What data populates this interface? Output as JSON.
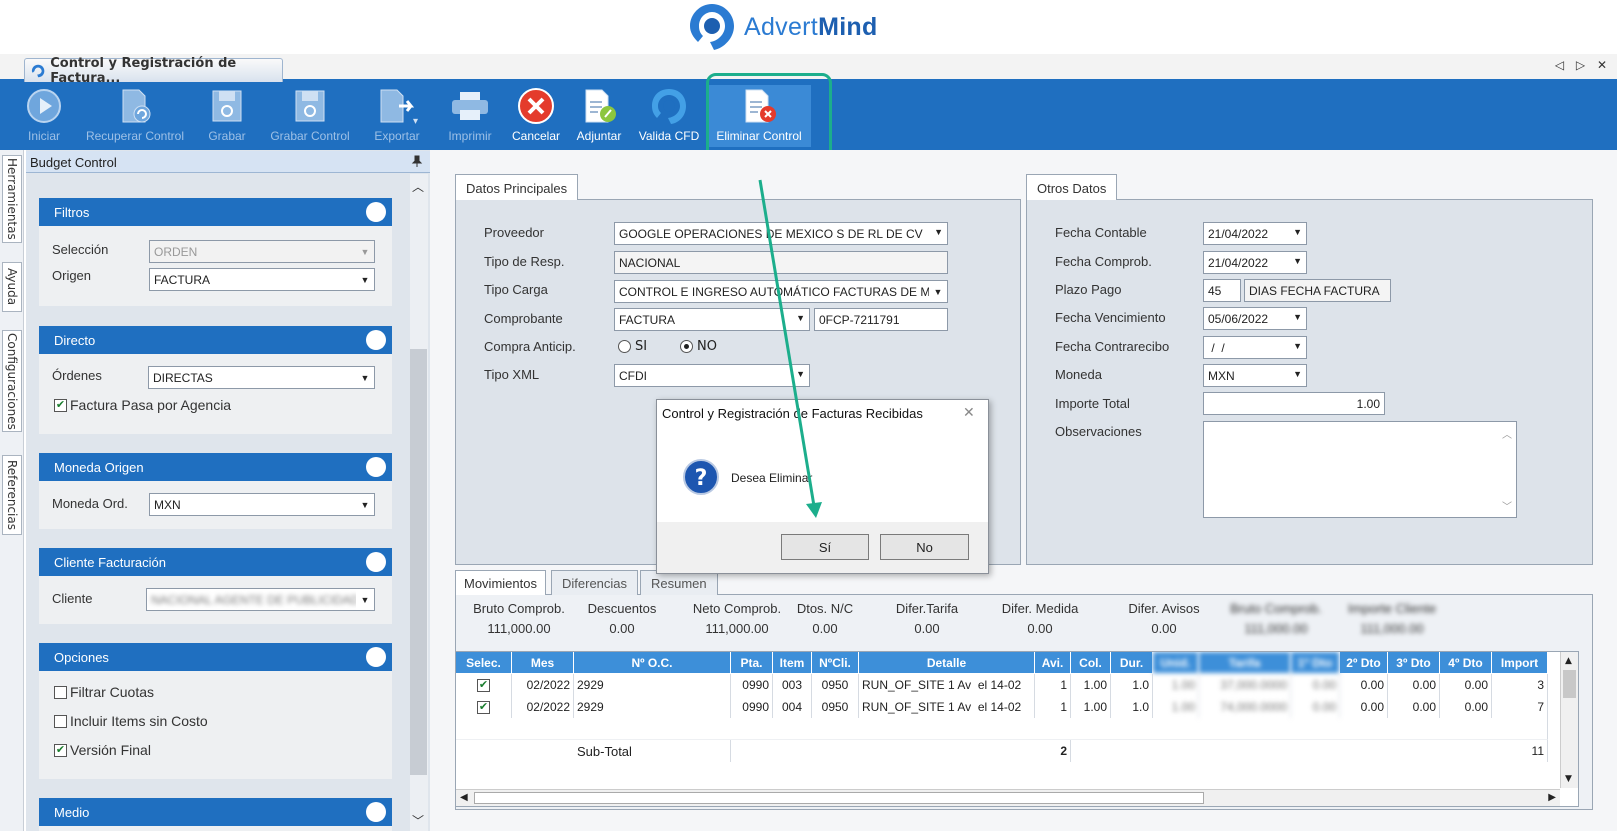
{
  "brand": {
    "name_light": "Advert",
    "name_bold": "Mind"
  },
  "window": {
    "tab_title": "Control y Registración de Factura...",
    "controls": "◁ ▷ ✕"
  },
  "toolbar": {
    "items": [
      {
        "label": "Iniciar",
        "enabled": false,
        "icon": "play-icon"
      },
      {
        "label": "Recuperar Control",
        "enabled": false,
        "icon": "document-refresh-icon"
      },
      {
        "label": "Grabar",
        "enabled": false,
        "icon": "save-icon"
      },
      {
        "label": "Grabar Control",
        "enabled": false,
        "icon": "save-control-icon"
      },
      {
        "label": "Exportar",
        "enabled": false,
        "icon": "export-icon"
      },
      {
        "label": "Imprimir",
        "enabled": false,
        "icon": "printer-icon"
      },
      {
        "label": "Cancelar",
        "enabled": true,
        "icon": "cancel-icon"
      },
      {
        "label": "Adjuntar",
        "enabled": true,
        "icon": "attach-icon"
      },
      {
        "label": "Valida CFD",
        "enabled": true,
        "icon": "validate-icon"
      },
      {
        "label": "Eliminar Control",
        "enabled": true,
        "icon": "delete-document-icon"
      }
    ]
  },
  "side_tabs": [
    "Herramientas",
    "Ayuda",
    "Configuraciones",
    "Referencias"
  ],
  "panel": {
    "title": "Budget Control",
    "filtros": {
      "title": "Filtros",
      "seleccion_label": "Selección",
      "seleccion_value": "ORDEN",
      "origen_label": "Origen",
      "origen_value": "FACTURA"
    },
    "directo": {
      "title": "Directo",
      "ordenes_label": "Órdenes",
      "ordenes_value": "DIRECTAS",
      "check_label": "Factura Pasa por Agencia",
      "checked": true
    },
    "moneda": {
      "title": "Moneda Origen",
      "label": "Moneda Ord.",
      "value": "MXN"
    },
    "cliente": {
      "title": "Cliente Facturación",
      "label": "Cliente",
      "value": "NACIONAL AGENTE DE PUBLICIDAD S.A."
    },
    "opciones": {
      "title": "Opciones",
      "items": [
        {
          "label": "Filtrar Cuotas",
          "checked": false
        },
        {
          "label": "Incluir Items sin Costo",
          "checked": false
        },
        {
          "label": "Versión Final",
          "checked": true
        }
      ]
    },
    "medio": {
      "title": "Medio"
    }
  },
  "datos": {
    "tab": "Datos Principales",
    "proveedor_label": "Proveedor",
    "proveedor_value": "GOOGLE OPERACIONES DE MEXICO S DE RL DE CV",
    "tipo_resp_label": "Tipo de Resp.",
    "tipo_resp_value": "NACIONAL",
    "tipo_carga_label": "Tipo Carga",
    "tipo_carga_value": "CONTROL E INGRESO AUTOMÁTICO FACTURAS DE MED",
    "comprobante_label": "Comprobante",
    "comprobante_value": "FACTURA",
    "comprobante_num": "0FCP-7211791",
    "compra_label": "Compra Anticip.",
    "si_label": "SI",
    "no_label": "NO",
    "tipo_xml_label": "Tipo XML",
    "tipo_xml_value": "CFDI"
  },
  "otros": {
    "tab": "Otros Datos",
    "fecha_contable_label": "Fecha Contable",
    "fecha_contable": "21/04/2022",
    "fecha_comprob_label": "Fecha Comprob.",
    "fecha_comprob": "21/04/2022",
    "plazo_label": "Plazo Pago",
    "plazo_value": "45",
    "plazo_tipo": "DIAS FECHA FACTURA",
    "fecha_venc_label": "Fecha Vencimiento",
    "fecha_venc": "05/06/2022",
    "fecha_contra_label": "Fecha Contrarecibo",
    "fecha_contra": " /  /",
    "moneda_label": "Moneda",
    "moneda_value": "MXN",
    "importe_label": "Importe Total",
    "importe_value": "1.00",
    "obs_label": "Observaciones"
  },
  "lower_tabs": [
    "Movimientos",
    "Diferencias",
    "Resumen"
  ],
  "summary": [
    {
      "label": "Bruto Comprob.",
      "value": "111,000.00"
    },
    {
      "label": "Descuentos",
      "value": "0.00"
    },
    {
      "label": "Neto Comprob.",
      "value": "111,000.00"
    },
    {
      "label": "Dtos. N/C",
      "value": "0.00"
    },
    {
      "label": "Difer.Tarifa",
      "value": "0.00"
    },
    {
      "label": "Difer. Medida",
      "value": "0.00"
    },
    {
      "label": "Difer. Avisos",
      "value": "0.00"
    },
    {
      "label": "Bruto Comprob.",
      "value": "111,000.00",
      "blurred": true
    },
    {
      "label": "Importe Cliente",
      "value": "111,000.00",
      "blurred": true
    }
  ],
  "grid": {
    "columns": [
      "Selec.",
      "Mes",
      "Nº O.C.",
      "Pta.",
      "Item",
      "NºCli.",
      "Detalle",
      "Avi.",
      "Col.",
      "Dur.",
      "Unid.",
      "Tarifa",
      "1º Dto",
      "2º Dto",
      "3º Dto",
      "4º Dto",
      "Import"
    ],
    "rows": [
      [
        "",
        "02/2022",
        "2929",
        "0990",
        "003",
        "0950",
        "RUN_OF_SITE 1 Av  el 14-02",
        "1",
        "1.00",
        "1.0",
        "1.00",
        "37,000.0000",
        "0.00",
        "0.00",
        "0.00",
        "0.00",
        "3"
      ],
      [
        "",
        "02/2022",
        "2929",
        "0990",
        "004",
        "0950",
        "RUN_OF_SITE 1 Av  el 14-02",
        "1",
        "1.00",
        "1.0",
        "1.00",
        "74,000.0000",
        "0.00",
        "0.00",
        "0.00",
        "0.00",
        "7"
      ]
    ],
    "subtotal_label": "Sub-Total",
    "subtotal_avi": "2",
    "subtotal_import": "11"
  },
  "dialog": {
    "title": "Control y Registración de Facturas Recibidas",
    "message": "Desea Eliminar",
    "yes": "Sí",
    "no": "No",
    "close": "✕"
  }
}
